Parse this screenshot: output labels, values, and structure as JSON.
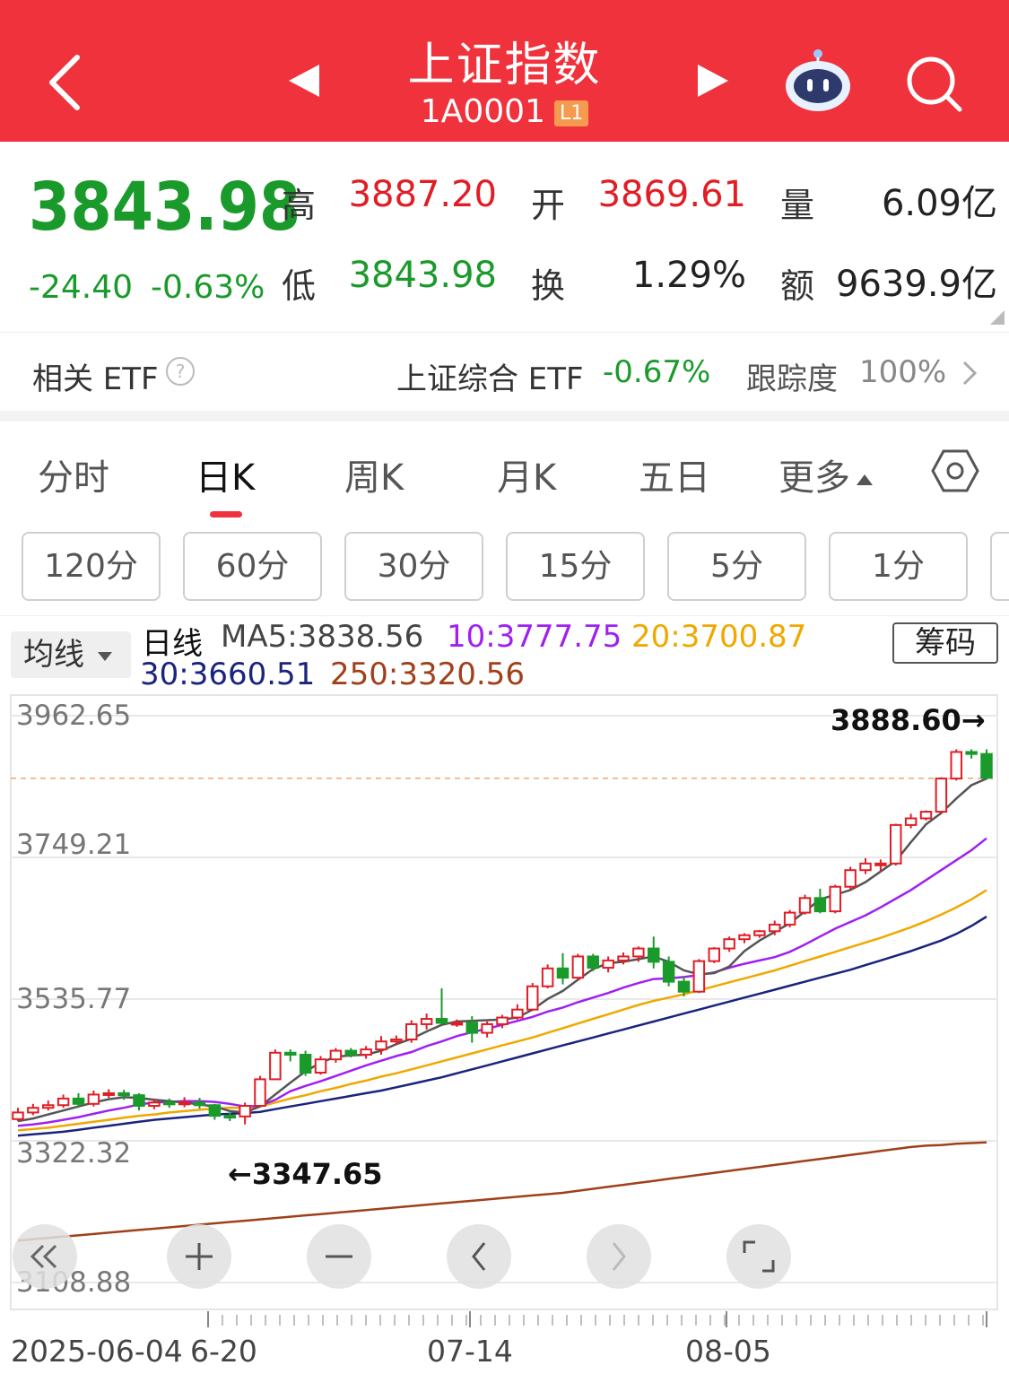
{
  "header": {
    "title": "上证指数",
    "code": "1A0001",
    "level_badge": "L1"
  },
  "quote": {
    "price": "3843.98",
    "change": "-24.40",
    "change_pct": "-0.63%",
    "high_label": "高",
    "high": "3887.20",
    "low_label": "低",
    "low": "3843.98",
    "open_label": "开",
    "open": "3869.61",
    "turnover_label": "换",
    "turnover": "1.29%",
    "volume_label": "量",
    "volume": "6.09亿",
    "amount_label": "额",
    "amount": "9639.9亿"
  },
  "etf": {
    "label": "相关 ETF",
    "name": "上证综合 ETF",
    "change": "-0.67%",
    "track_label": "跟踪度",
    "track": "100%"
  },
  "tabs": [
    "分时",
    "日K",
    "周K",
    "月K",
    "五日",
    "更多"
  ],
  "minute_buttons": [
    "120分",
    "60分",
    "30分",
    "15分",
    "5分",
    "1分"
  ],
  "indicator": {
    "select_label": "均线",
    "period": "日线",
    "ma5": "MA5:3838.56",
    "ma10": "10:3777.75",
    "ma20": "20:3700.87",
    "ma30": "30:3660.51",
    "ma250": "250:3320.56",
    "chip_button": "筹码"
  },
  "colors": {
    "header": "#f0323c",
    "up": "#e11d25",
    "down": "#1a9a2b",
    "ma5": "#555555",
    "ma10": "#a020f0",
    "ma20": "#f0a800",
    "ma30": "#1a237e",
    "ma250": "#a0401a"
  },
  "chart_data": {
    "type": "candlestick",
    "y_ticks": [
      "3962.65",
      "3749.21",
      "3535.77",
      "3322.32",
      "3108.88"
    ],
    "x_labels": [
      "2025-06-04",
      "6-20",
      "07-14",
      "08-05"
    ],
    "max_label": "3888.60→",
    "min_label": "←3347.65",
    "reference_price": 3868.38,
    "candles": [
      [
        3355,
        3365,
        3352,
        3372
      ],
      [
        3365,
        3372,
        3361,
        3378
      ],
      [
        3372,
        3376,
        3368,
        3383
      ],
      [
        3376,
        3386,
        3372,
        3392
      ],
      [
        3386,
        3378,
        3372,
        3394
      ],
      [
        3378,
        3392,
        3374,
        3398
      ],
      [
        3392,
        3394,
        3387,
        3400
      ],
      [
        3394,
        3391,
        3384,
        3399
      ],
      [
        3391,
        3375,
        3368,
        3394
      ],
      [
        3375,
        3380,
        3370,
        3386
      ],
      [
        3380,
        3378,
        3372,
        3386
      ],
      [
        3378,
        3380,
        3373,
        3388
      ],
      [
        3380,
        3376,
        3371,
        3387
      ],
      [
        3376,
        3360,
        3354,
        3378
      ],
      [
        3360,
        3359,
        3352,
        3365
      ],
      [
        3359,
        3375,
        3347,
        3380
      ],
      [
        3375,
        3415,
        3374,
        3420
      ],
      [
        3415,
        3455,
        3414,
        3460
      ],
      [
        3455,
        3452,
        3442,
        3460
      ],
      [
        3452,
        3425,
        3420,
        3458
      ],
      [
        3425,
        3445,
        3422,
        3450
      ],
      [
        3445,
        3458,
        3440,
        3462
      ],
      [
        3458,
        3452,
        3448,
        3462
      ],
      [
        3452,
        3460,
        3446,
        3465
      ],
      [
        3460,
        3472,
        3452,
        3480
      ],
      [
        3472,
        3475,
        3467,
        3481
      ],
      [
        3475,
        3498,
        3470,
        3504
      ],
      [
        3498,
        3506,
        3490,
        3514
      ],
      [
        3506,
        3500,
        3498,
        3552
      ],
      [
        3500,
        3500,
        3494,
        3505
      ],
      [
        3500,
        3485,
        3470,
        3510
      ],
      [
        3485,
        3498,
        3478,
        3502
      ],
      [
        3498,
        3508,
        3492,
        3512
      ],
      [
        3508,
        3520,
        3505,
        3528
      ],
      [
        3520,
        3555,
        3518,
        3560
      ],
      [
        3555,
        3582,
        3552,
        3588
      ],
      [
        3582,
        3568,
        3558,
        3605
      ],
      [
        3568,
        3600,
        3564,
        3604
      ],
      [
        3600,
        3583,
        3578,
        3604
      ],
      [
        3583,
        3594,
        3576,
        3600
      ],
      [
        3594,
        3600,
        3588,
        3606
      ],
      [
        3600,
        3612,
        3592,
        3615
      ],
      [
        3612,
        3592,
        3582,
        3630
      ],
      [
        3592,
        3562,
        3555,
        3600
      ],
      [
        3562,
        3547,
        3540,
        3570
      ],
      [
        3547,
        3593,
        3545,
        3596
      ],
      [
        3593,
        3612,
        3590,
        3614
      ],
      [
        3612,
        3626,
        3607,
        3630
      ],
      [
        3626,
        3632,
        3620,
        3635
      ],
      [
        3632,
        3638,
        3628,
        3640
      ],
      [
        3638,
        3648,
        3632,
        3654
      ],
      [
        3648,
        3666,
        3644,
        3670
      ],
      [
        3666,
        3688,
        3663,
        3693
      ],
      [
        3688,
        3668,
        3665,
        3702
      ],
      [
        3668,
        3705,
        3665,
        3708
      ],
      [
        3705,
        3730,
        3700,
        3735
      ],
      [
        3730,
        3740,
        3724,
        3748
      ],
      [
        3740,
        3740,
        3728,
        3746
      ],
      [
        3740,
        3798,
        3737,
        3800
      ],
      [
        3798,
        3808,
        3793,
        3815
      ],
      [
        3808,
        3818,
        3805,
        3820
      ],
      [
        3818,
        3868,
        3815,
        3870
      ],
      [
        3868,
        3908,
        3865,
        3912
      ],
      [
        3908,
        3905,
        3898,
        3912
      ],
      [
        3905,
        3869,
        3866,
        3912
      ]
    ],
    "ma5": [
      3352,
      3356,
      3362,
      3368,
      3374,
      3380,
      3385,
      3388,
      3387,
      3384,
      3382,
      3380,
      3377,
      3374,
      3367,
      3365,
      3374,
      3392,
      3410,
      3427,
      3440,
      3449,
      3451,
      3452,
      3458,
      3468,
      3476,
      3487,
      3497,
      3502,
      3503,
      3504,
      3505,
      3508,
      3520,
      3536,
      3548,
      3565,
      3581,
      3590,
      3592,
      3596,
      3600,
      3592,
      3579,
      3573,
      3575,
      3585,
      3608,
      3624,
      3637,
      3650,
      3668,
      3686,
      3693,
      3700,
      3712,
      3728,
      3744,
      3772,
      3799,
      3816,
      3838,
      3858,
      3868
    ],
    "ma10": [
      3345,
      3347,
      3350,
      3354,
      3358,
      3363,
      3368,
      3372,
      3377,
      3380,
      3381,
      3382,
      3382,
      3381,
      3378,
      3374,
      3375,
      3384,
      3397,
      3405,
      3412,
      3420,
      3428,
      3436,
      3443,
      3450,
      3456,
      3465,
      3472,
      3480,
      3486,
      3491,
      3497,
      3503,
      3509,
      3517,
      3523,
      3531,
      3538,
      3545,
      3553,
      3560,
      3566,
      3567,
      3569,
      3572,
      3576,
      3583,
      3589,
      3594,
      3599,
      3607,
      3618,
      3630,
      3642,
      3652,
      3662,
      3674,
      3687,
      3700,
      3715,
      3730,
      3745,
      3760,
      3778
    ],
    "ma20": [
      3338,
      3340,
      3342,
      3345,
      3348,
      3351,
      3354,
      3357,
      3360,
      3362,
      3365,
      3367,
      3369,
      3371,
      3372,
      3372,
      3374,
      3380,
      3386,
      3391,
      3397,
      3402,
      3408,
      3413,
      3419,
      3424,
      3430,
      3436,
      3442,
      3448,
      3454,
      3460,
      3466,
      3472,
      3478,
      3485,
      3492,
      3499,
      3506,
      3513,
      3520,
      3527,
      3533,
      3538,
      3543,
      3549,
      3555,
      3561,
      3567,
      3573,
      3579,
      3586,
      3593,
      3600,
      3607,
      3614,
      3621,
      3628,
      3636,
      3644,
      3653,
      3663,
      3674,
      3686,
      3700
    ],
    "ma30": [
      3330,
      3332,
      3334,
      3336,
      3339,
      3342,
      3345,
      3348,
      3351,
      3354,
      3356,
      3358,
      3360,
      3362,
      3363,
      3364,
      3366,
      3370,
      3374,
      3378,
      3382,
      3386,
      3390,
      3394,
      3398,
      3403,
      3408,
      3413,
      3418,
      3424,
      3430,
      3436,
      3442,
      3448,
      3454,
      3460,
      3466,
      3472,
      3478,
      3484,
      3490,
      3496,
      3502,
      3508,
      3514,
      3520,
      3526,
      3532,
      3538,
      3544,
      3550,
      3556,
      3562,
      3568,
      3574,
      3580,
      3587,
      3594,
      3601,
      3608,
      3616,
      3624,
      3634,
      3646,
      3660
    ],
    "ma250": [
      3172,
      3174,
      3176,
      3178,
      3180,
      3182,
      3184,
      3186,
      3188,
      3190,
      3192,
      3194,
      3196,
      3198,
      3200,
      3202,
      3204,
      3206,
      3208,
      3210,
      3212,
      3214,
      3216,
      3218,
      3220,
      3222,
      3224,
      3226,
      3228,
      3230,
      3232,
      3234,
      3236,
      3238,
      3240,
      3242,
      3244,
      3247,
      3250,
      3253,
      3256,
      3259,
      3262,
      3265,
      3268,
      3271,
      3274,
      3277,
      3280,
      3283,
      3286,
      3289,
      3292,
      3295,
      3298,
      3301,
      3304,
      3307,
      3310,
      3313,
      3315,
      3316,
      3318,
      3319,
      3320
    ]
  }
}
